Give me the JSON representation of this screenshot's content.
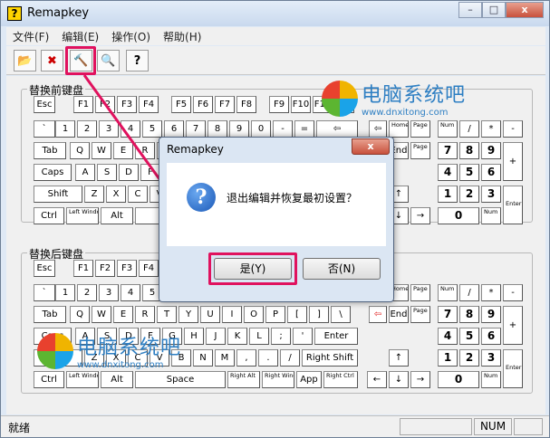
{
  "window": {
    "title": "Remapkey",
    "icon_glyph": "?",
    "minimize": "–",
    "maximize": "□",
    "close": "x"
  },
  "menu": [
    "文件(F)",
    "编辑(E)",
    "操作(O)",
    "帮助(H)"
  ],
  "toolbar": [
    {
      "name": "open-file-tool",
      "glyph": "📂"
    },
    {
      "name": "exit-tool",
      "glyph": "✖"
    },
    {
      "name": "remap-hammer-tool",
      "glyph": "🔨"
    },
    {
      "name": "search-tool",
      "glyph": "🔍"
    },
    {
      "name": "help-tool",
      "glyph": "?"
    }
  ],
  "highlight_color": "#e0125e",
  "groups": {
    "before": "替换前键盘",
    "after": "替换后键盘"
  },
  "keys": {
    "esc": "Esc",
    "f": [
      "F1",
      "F2",
      "F3",
      "F4",
      "F5",
      "F6",
      "F7",
      "F8",
      "F9",
      "F10",
      "F11",
      "F12"
    ],
    "num_row": [
      "`",
      "1",
      "2",
      "3",
      "4",
      "5",
      "6",
      "7",
      "8",
      "9",
      "0",
      "-",
      "=",
      "⇦"
    ],
    "tab": "Tab",
    "q_row": [
      "Q",
      "W",
      "E",
      "R",
      "T",
      "Y",
      "U",
      "I",
      "O",
      "P",
      "[",
      "]",
      "\\"
    ],
    "caps": "Caps",
    "a_row": [
      "A",
      "S",
      "D",
      "F",
      "G",
      "H",
      "J",
      "K",
      "L",
      ";",
      "'"
    ],
    "enter": "Enter",
    "shift": "Shift",
    "z_row": [
      "Z",
      "X",
      "C",
      "V",
      "B",
      "N",
      "M",
      ",",
      ".",
      "/"
    ],
    "right_shift": "Right Shift",
    "ctrl": "Ctrl",
    "left_windows": "Left Windows",
    "alt": "Alt",
    "space": "Space",
    "right_alt": "Right Alt",
    "right_windows": "Right Windows",
    "app": "App",
    "right_ctrl": "Right Ctrl",
    "home": "Home",
    "end": "End",
    "page_up": "Page Up",
    "page_down": "Page Down",
    "arrows": [
      "↑",
      "←",
      "↓",
      "→"
    ],
    "num_lock": "Num Lock",
    "num_ops": [
      "/",
      "*",
      "-",
      "+"
    ],
    "num_789": [
      "7",
      "8",
      "9"
    ],
    "num_456": [
      "4",
      "5",
      "6"
    ],
    "num_123": [
      "1",
      "2",
      "3"
    ],
    "num_0": "0",
    "num_del": "Num Del",
    "num_enter": "Enter"
  },
  "dialog": {
    "title": "Remapkey",
    "close": "x",
    "message": "退出编辑并恢复最初设置？",
    "yes": "是(Y)",
    "no": "否(N)"
  },
  "status": {
    "text": "就绪",
    "num": "NUM"
  },
  "watermark": {
    "title": "电脑系统吧",
    "url": "www.dnxitong.com"
  }
}
